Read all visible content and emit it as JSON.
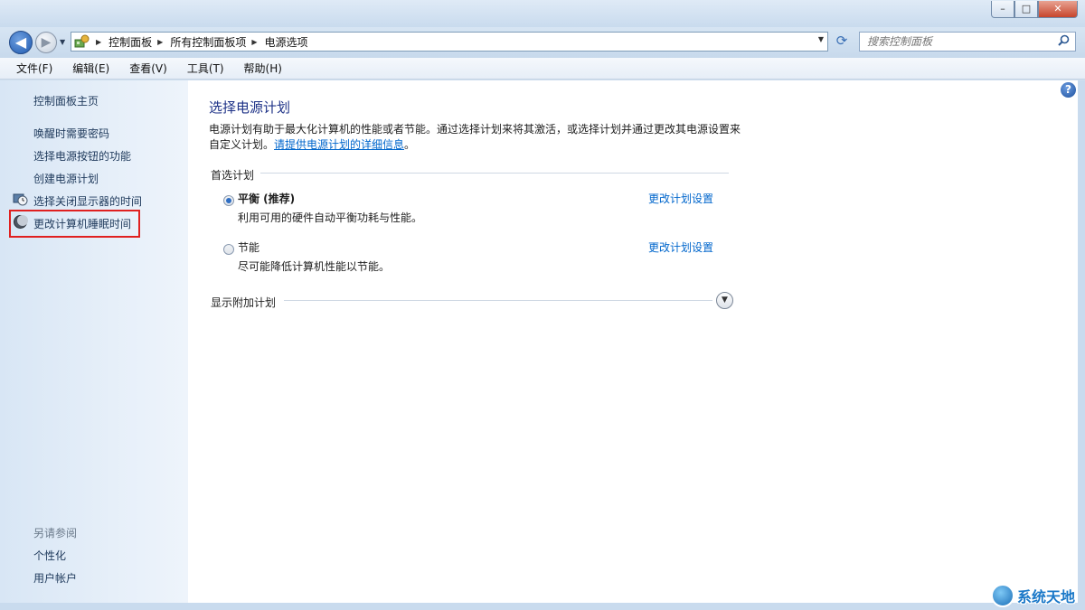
{
  "window": {
    "minimize": "–",
    "maximize": "□",
    "close": "✕"
  },
  "nav": {
    "back_glyph": "◀",
    "forward_glyph": "▶",
    "breadcrumbs": [
      "控制面板",
      "所有控制面板项",
      "电源选项"
    ],
    "search_placeholder": "搜索控制面板"
  },
  "menubar": {
    "items": [
      "文件(F)",
      "编辑(E)",
      "查看(V)",
      "工具(T)",
      "帮助(H)"
    ]
  },
  "sidebar": {
    "home": "控制面板主页",
    "items": [
      {
        "label": "唤醒时需要密码",
        "icon": ""
      },
      {
        "label": "选择电源按钮的功能",
        "icon": ""
      },
      {
        "label": "创建电源计划",
        "icon": ""
      },
      {
        "label": "选择关闭显示器的时间",
        "icon": "monitor-clock-icon"
      },
      {
        "label": "更改计算机睡眠时间",
        "icon": "moon-icon"
      }
    ],
    "see_also_title": "另请参阅",
    "see_also": [
      "个性化",
      "用户帐户"
    ]
  },
  "main": {
    "title": "选择电源计划",
    "description": "电源计划有助于最大化计算机的性能或者节能。通过选择计划来将其激活，或选择计划并通过更改其电源设置来自定义计划。",
    "description_link": "请提供电源计划的详细信息",
    "description_end": "。",
    "preferred_label": "首选计划",
    "plans": [
      {
        "name": "平衡 (推荐)",
        "desc": "利用可用的硬件自动平衡功耗与性能。",
        "link": "更改计划设置",
        "selected": true
      },
      {
        "name": "节能",
        "desc": "尽可能降低计算机性能以节能。",
        "link": "更改计划设置",
        "selected": false
      }
    ],
    "additional_label": "显示附加计划"
  },
  "watermark": "系统天地",
  "colors": {
    "title": "#1e3287",
    "link": "#0066cc",
    "highlight": "#e02020"
  }
}
